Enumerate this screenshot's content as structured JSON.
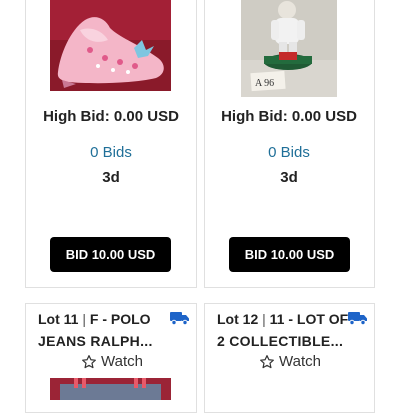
{
  "lots": [
    {
      "high_bid": "High Bid: 0.00 USD",
      "bids": "0 Bids",
      "time_left": "3d",
      "bid_button": "BID 10.00 USD",
      "image_icon": "shoe-icon"
    },
    {
      "high_bid": "High Bid: 0.00 USD",
      "bids": "0 Bids",
      "time_left": "3d",
      "bid_button": "BID 10.00 USD",
      "image_icon": "figurine-icon",
      "image_tag": "A 96"
    },
    {
      "lot_label": "Lot 11",
      "separator": "|",
      "title_line1": "F - POLO",
      "title_line2": "JEANS RALPH...",
      "watch_label": "Watch",
      "shipping_icon": "truck-icon",
      "image_icon": "bag-icon"
    },
    {
      "lot_label": "Lot 12",
      "separator": "|",
      "title_line1": "11 - LOT OF",
      "title_line2": "2 COLLECTIBLE...",
      "watch_label": "Watch",
      "shipping_icon": "truck-icon"
    }
  ],
  "colors": {
    "accent_blue": "#1f6f98",
    "button_bg": "#000000",
    "shipping_blue": "#1e64c8"
  }
}
